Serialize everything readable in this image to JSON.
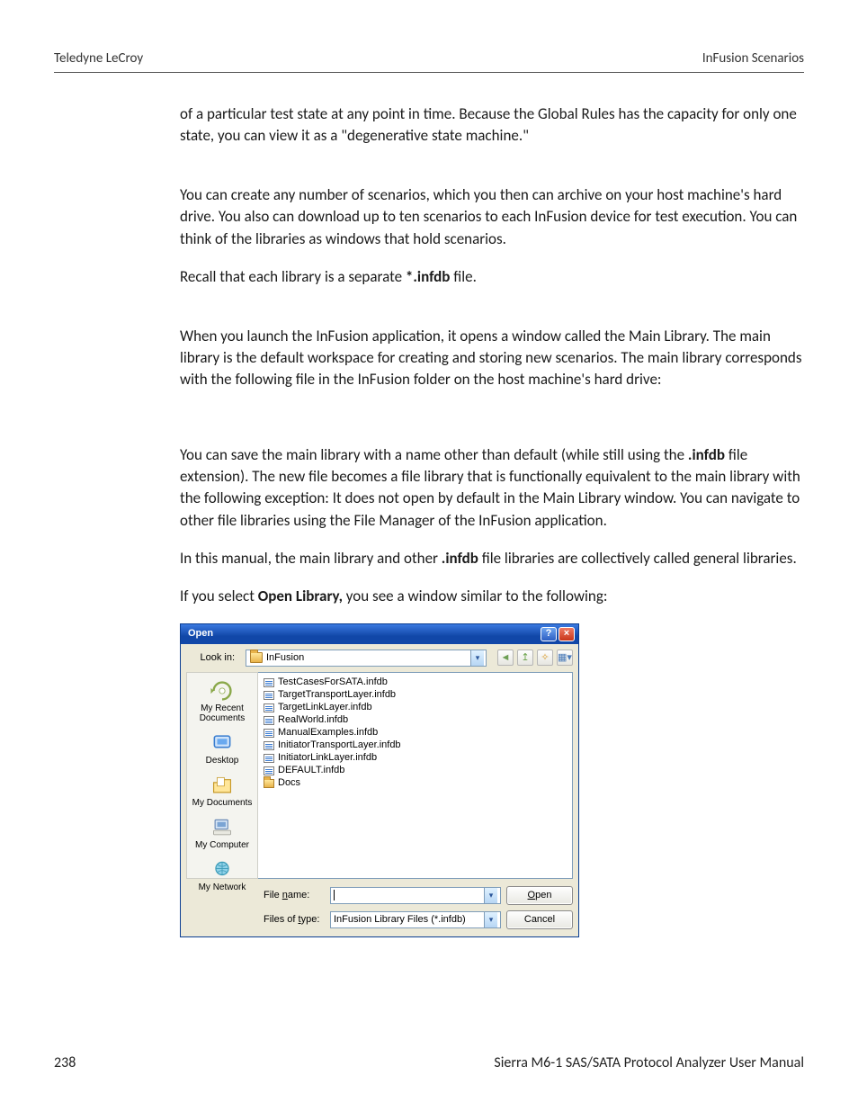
{
  "header": {
    "left": "Teledyne LeCroy",
    "right": "InFusion Scenarios"
  },
  "body": {
    "p1": "of a particular test state at any point in time. Because the Global Rules has the capacity for only one state, you can view it as a \"degenerative state machine.\"",
    "p2": "You can create any number of scenarios, which you then can archive on your host machine's hard drive. You also can download up to ten scenarios to each InFusion device for test execution. You can think of the libraries as windows that hold scenarios.",
    "p3a": "Recall that each library is a separate ",
    "p3b": "*.infdb",
    "p3c": " file.",
    "p4": "When you launch the InFusion application, it opens a window called the Main Library. The main library is the default workspace for creating and storing new scenarios. The main library corresponds with the following file in the InFusion folder on the host machine's hard drive:",
    "p5a": "You can save the main library with a name other than default (while still using the ",
    "p5b": ".infdb",
    "p5c": " file extension). The new file becomes a file library that is functionally equivalent to the main library with the following exception: It does not open by default in the Main Library window. You can navigate to other file libraries using the File Manager of the InFusion application.",
    "p6a": "In this manual, the main library and other ",
    "p6b": ".infdb",
    "p6c": " file libraries are collectively called general libraries.",
    "p7a": "If you select ",
    "p7b": "Open Library,",
    "p7c": " you see a window similar to the following:"
  },
  "dialog": {
    "title": "Open",
    "lookin_label": "Look in:",
    "lookin_value": "InFusion",
    "places": [
      {
        "id": "recent",
        "label": "My Recent Documents"
      },
      {
        "id": "desktop",
        "label": "Desktop"
      },
      {
        "id": "mydocs",
        "label": "My Documents"
      },
      {
        "id": "mycomp",
        "label": "My Computer"
      },
      {
        "id": "mynet",
        "label": "My Network"
      }
    ],
    "files": [
      "TestCasesForSATA.infdb",
      "TargetTransportLayer.infdb",
      "TargetLinkLayer.infdb",
      "RealWorld.infdb",
      "ManualExamples.infdb",
      "InitiatorTransportLayer.infdb",
      "InitiatorLinkLayer.infdb",
      "DEFAULT.infdb"
    ],
    "folder_item": "Docs",
    "filename_label": "File name:",
    "filename_value": "",
    "filetype_label": "Files of type:",
    "filetype_value": "InFusion Library Files (*.infdb)",
    "open_btn": "Open",
    "cancel_btn": "Cancel"
  },
  "footer": {
    "page": "238",
    "title": "Sierra M6-1 SAS/SATA Protocol Analyzer User Manual"
  }
}
